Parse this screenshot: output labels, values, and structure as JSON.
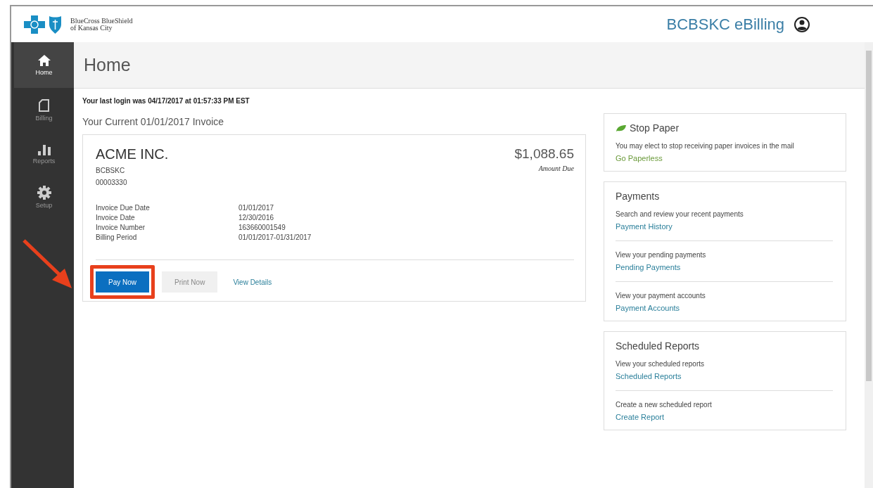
{
  "header": {
    "org_name": "BlueCross BlueShield\nof Kansas City",
    "app_title": "BCBSKC eBilling"
  },
  "sidebar": {
    "items": [
      {
        "label": "Home",
        "kind": "home",
        "selected": true
      },
      {
        "label": "Billing",
        "kind": "billing",
        "selected": false
      },
      {
        "label": "Reports",
        "kind": "reports",
        "selected": false
      },
      {
        "label": "Setup",
        "kind": "setup",
        "selected": false
      }
    ]
  },
  "page_title": "Home",
  "last_login": "Your last login was 04/17/2017 at 01:57:33 PM EST",
  "invoice_heading": "Your Current 01/01/2017 Invoice",
  "invoice": {
    "company": "ACME INC.",
    "payer": "BCBSKC",
    "account": "00003330",
    "amount": "$1,088.65",
    "amount_label": "Amount Due",
    "details": [
      {
        "label": "Invoice Due Date",
        "value": "01/01/2017"
      },
      {
        "label": "Invoice Date",
        "value": "12/30/2016"
      },
      {
        "label": "Invoice Number",
        "value": "163660001549"
      },
      {
        "label": "Billing Period",
        "value": "01/01/2017-01/31/2017"
      }
    ],
    "actions": [
      {
        "label": "Pay Now",
        "kind": "primary"
      },
      {
        "label": "Print Now",
        "kind": "secondary"
      },
      {
        "label": "View Details",
        "kind": "link"
      }
    ]
  },
  "panels": [
    {
      "title": "Stop Paper",
      "kind": "leaf",
      "sections": [
        {
          "text": "You may elect to stop receiving paper invoices in the mail",
          "link": "Go Paperless",
          "color": "#6a9a3a"
        }
      ]
    },
    {
      "title": "Payments",
      "kind": "plain",
      "sections": [
        {
          "text": "Search and review your recent payments",
          "link": "Payment History",
          "color": "#2a7f9a"
        },
        {
          "text": "View your pending payments",
          "link": "Pending Payments",
          "color": "#2a7f9a"
        },
        {
          "text": "View your payment accounts",
          "link": "Payment Accounts",
          "color": "#2a7f9a"
        }
      ]
    },
    {
      "title": "Scheduled Reports",
      "kind": "plain",
      "sections": [
        {
          "text": "View your scheduled reports",
          "link": "Scheduled Reports",
          "color": "#2a7f9a"
        },
        {
          "text": "Create a new scheduled report",
          "link": "Create Report",
          "color": "#2a7f9a"
        }
      ]
    }
  ],
  "callout": {
    "arrow": true,
    "frame": true
  }
}
